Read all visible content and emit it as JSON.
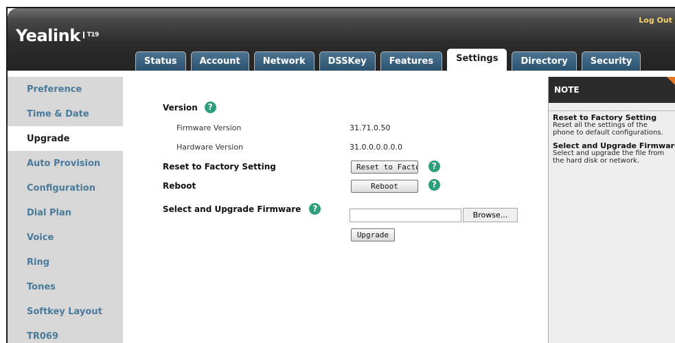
{
  "header": {
    "logo_text": "Yealink",
    "model": "T19",
    "logout_label": "Log Out"
  },
  "tabs": [
    {
      "label": "Status"
    },
    {
      "label": "Account"
    },
    {
      "label": "Network"
    },
    {
      "label": "DSSKey"
    },
    {
      "label": "Features"
    },
    {
      "label": "Settings",
      "active": true
    },
    {
      "label": "Directory"
    },
    {
      "label": "Security"
    }
  ],
  "sidebar": {
    "items": [
      {
        "label": "Preference"
      },
      {
        "label": "Time & Date"
      },
      {
        "label": "Upgrade",
        "active": true
      },
      {
        "label": "Auto Provision"
      },
      {
        "label": "Configuration"
      },
      {
        "label": "Dial Plan"
      },
      {
        "label": "Voice"
      },
      {
        "label": "Ring"
      },
      {
        "label": "Tones"
      },
      {
        "label": "Softkey Layout"
      },
      {
        "label": "TR069"
      }
    ]
  },
  "main": {
    "version_label": "Version",
    "firmware_label": "Firmware Version",
    "firmware_value": "31.71.0.50",
    "hardware_label": "Hardware Version",
    "hardware_value": "31.0.0.0.0.0.0",
    "reset_label": "Reset to Factory Setting",
    "reset_button": "Reset to Factory Setting",
    "reboot_label": "Reboot",
    "reboot_button": "Reboot",
    "upgrade_label": "Select and Upgrade Firmware",
    "file_value": "",
    "browse_button": "Browse...",
    "upgrade_button": "Upgrade",
    "help_glyph": "?"
  },
  "note": {
    "title": "NOTE",
    "items": [
      {
        "title": "Reset to Factory Setting",
        "line1": "Reset all the settings of the",
        "line2": "phone to default configurations."
      },
      {
        "title": "Select and Upgrade Firmware",
        "line1": "Select and upgrade the file from",
        "line2": "the hard disk or network."
      }
    ]
  },
  "colors": {
    "tab_blue": "#2c5270",
    "sidebar_link": "#4a7a9a",
    "help_green": "#2e9e7c",
    "note_accent": "#e87722",
    "logout_gold": "#f5d36a"
  }
}
